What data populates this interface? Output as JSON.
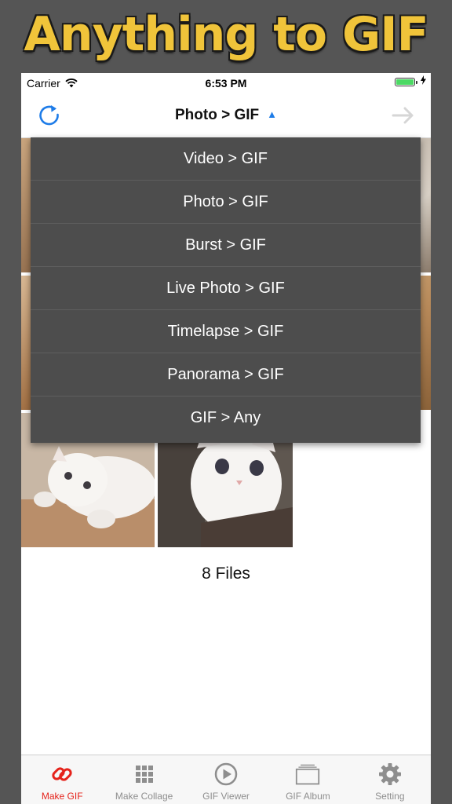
{
  "banner": {
    "title": "Anything to GIF"
  },
  "status_bar": {
    "carrier": "Carrier",
    "time": "6:53 PM"
  },
  "nav": {
    "title": "Photo > GIF"
  },
  "dropdown": {
    "items": [
      "Video > GIF",
      "Photo > GIF",
      "Burst > GIF",
      "Live Photo > GIF",
      "Timelapse > GIF",
      "Panorama > GIF",
      "GIF > Any"
    ]
  },
  "files_count": "8 Files",
  "tabbar": {
    "tabs": [
      {
        "label": "Make GIF",
        "icon": "link-icon",
        "active": true
      },
      {
        "label": "Make Collage",
        "icon": "grid-icon",
        "active": false
      },
      {
        "label": "GIF Viewer",
        "icon": "play-circle-icon",
        "active": false
      },
      {
        "label": "GIF Album",
        "icon": "album-icon",
        "active": false
      },
      {
        "label": "Setting",
        "icon": "gear-icon",
        "active": false
      }
    ]
  },
  "colors": {
    "accent_blue": "#1e7ce8",
    "active_tab_red": "#e5231b",
    "banner_gold": "#f0c43a",
    "menu_bg": "#4d4d4d",
    "frame_gray": "#555555"
  }
}
